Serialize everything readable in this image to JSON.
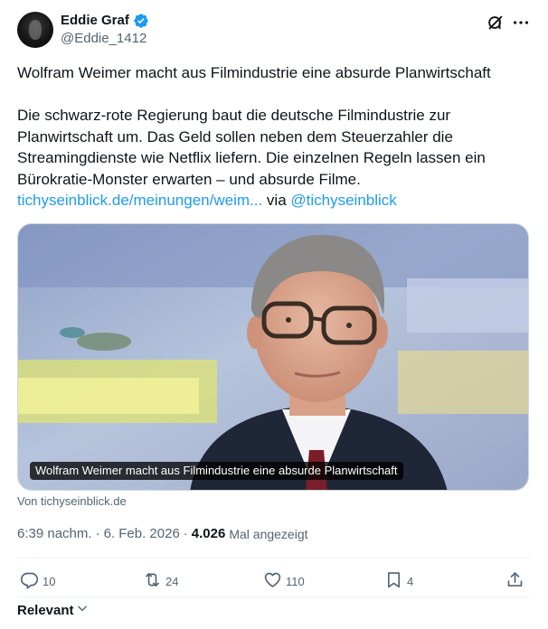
{
  "author": {
    "display_name": "Eddie Graf",
    "handle": "@Eddie_1412",
    "verified": true
  },
  "post": {
    "headline": "Wolfram Weimer macht aus Filmindustrie eine absurde Planwirtschaft",
    "body": "Die schwarz-rote Regierung baut die deutsche Filmindustrie zur Planwirtschaft um. Das Geld sollen neben dem Steuerzahler die Streamingdienste wie Netflix liefern. Die einzelnen Regeln lassen ein Bürokratie-Monster erwarten – und absurde Filme.",
    "link_text": "tichyseinblick.de/meinungen/weim...",
    "via_label": "via",
    "via_handle": "@tichyseinblick"
  },
  "card": {
    "caption": "Wolfram Weimer macht aus Filmindustrie eine absurde Planwirtschaft",
    "source": "Von tichyseinblick.de"
  },
  "meta": {
    "time": "6:39 nachm.",
    "separator": "·",
    "date": "6. Feb. 2026",
    "views_count": "4.026",
    "views_label": "Mal angezeigt"
  },
  "actions": {
    "replies": "10",
    "reposts": "24",
    "likes": "110",
    "bookmarks": "4"
  },
  "sort": {
    "label": "Relevant"
  },
  "icons": {
    "verified": "verified-badge-icon",
    "grok": "grok-icon",
    "more": "more-options-icon",
    "reply": "reply-icon",
    "repost": "repost-icon",
    "like": "heart-icon",
    "bookmark": "bookmark-icon",
    "share": "share-icon",
    "chevron": "chevron-down-icon"
  },
  "colors": {
    "accent": "#1d9bf0",
    "text": "#0f1419",
    "secondary": "#536471"
  }
}
